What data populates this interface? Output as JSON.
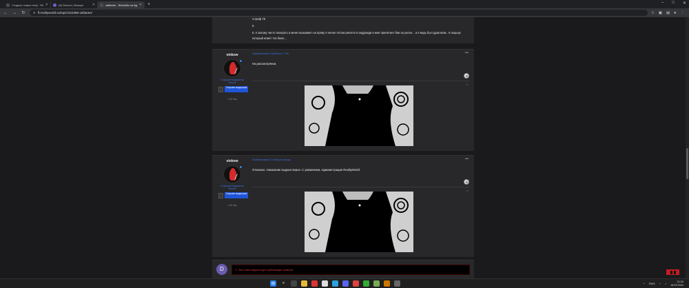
{
  "browser": {
    "tabs": [
      {
        "title": "Создать новую тему · RealityW...",
        "active": false
      },
      {
        "title": "(8) Discord | Вернул",
        "active": false
      },
      {
        "title": "забанен - Жалобы на Адми...",
        "active": true
      }
    ],
    "new_tab": "+",
    "address": "ff.realityworld.su/topic/223485-забанен/",
    "window_controls": [
      "–",
      "□",
      "✕"
    ]
  },
  "top_post": {
    "lines": [
      "4.гриф 78",
      "5.",
      "6. я захожу чисто поиграть и меня вызывают на прову я начал потом ригатся в андроидв и мне прилетает бан за уклон... а я ведь был драгоном.. я пацыэр",
      "который апает топ банл..."
    ]
  },
  "posts": [
    {
      "username": "vinkow",
      "role": "Старший Модератор",
      "role2": "Vinkow",
      "badge": "Старшая модерация",
      "reputation": "▪ 1,5 тыс",
      "meta": "Опубликовано Суббота в 7:30",
      "message": "На рассмотрении.",
      "more": "•••"
    },
    {
      "username": "vinkow",
      "role": "Старший Модератор",
      "role2": "Vinkow",
      "badge": "Старшая модерация",
      "reputation": "▪ 1,5 тыс",
      "meta": "Опубликовано 21 минуту назад",
      "message": "Отказано. Наказание выдано верно. С уважением, Администрация RealityWorld.",
      "more": "•••"
    }
  ],
  "reply": {
    "avatar_letter": "D",
    "locked_text": "⚠ Эта тема закрыта для публикации ответов."
  },
  "taskbar": {
    "time": "21:34",
    "date": "18.03.2024",
    "lang": "ENG"
  },
  "colors": {
    "accent": "#3b72e0",
    "badge": "#1f55d9",
    "danger": "#e53a3a",
    "panel": "#28282a"
  }
}
